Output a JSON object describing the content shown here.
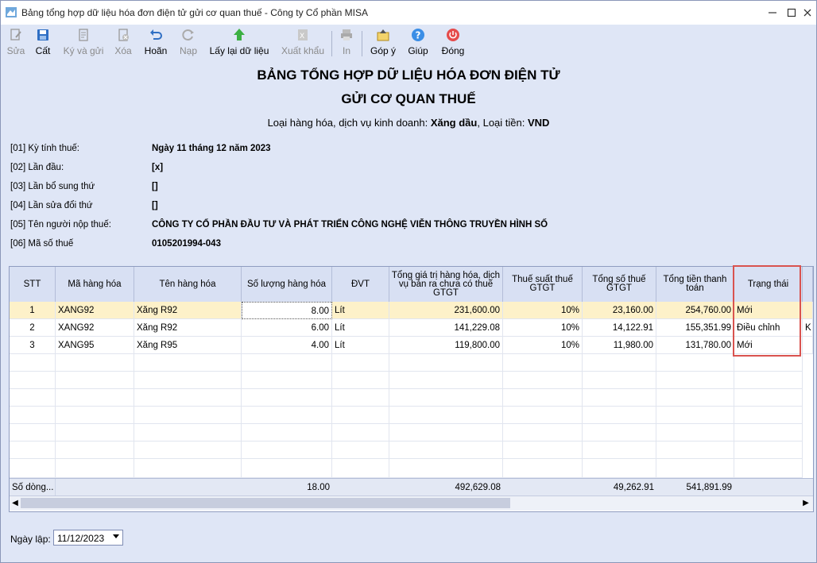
{
  "window": {
    "title": "Bảng tổng hợp dữ liệu hóa đơn điện tử gửi cơ quan thuế - Công ty Cổ phần MISA"
  },
  "toolbar": {
    "items": [
      {
        "label": "Sửa",
        "icon": "edit-icon",
        "disabled": true
      },
      {
        "label": "Cất",
        "icon": "save-icon",
        "disabled": false
      },
      {
        "label": "Ký và gửi",
        "icon": "sign-send-icon",
        "disabled": true
      },
      {
        "label": "Xóa",
        "icon": "delete-icon",
        "disabled": true
      },
      {
        "label": "Hoãn",
        "icon": "undo-icon",
        "disabled": false
      },
      {
        "label": "Nạp",
        "icon": "refresh-icon",
        "disabled": true
      },
      {
        "label": "Lấy lại dữ liệu",
        "icon": "reload-data-icon",
        "disabled": false
      },
      {
        "label": "Xuất khẩu",
        "icon": "export-icon",
        "disabled": true
      },
      {
        "label": "In",
        "icon": "print-icon",
        "disabled": true
      },
      {
        "label": "Góp ý",
        "icon": "feedback-icon",
        "disabled": false
      },
      {
        "label": "Giúp",
        "icon": "help-icon",
        "disabled": false
      },
      {
        "label": "Đóng",
        "icon": "close-power-icon",
        "disabled": false
      }
    ]
  },
  "report": {
    "title_line1": "BẢNG TỔNG HỢP DỮ LIỆU HÓA ĐƠN ĐIỆN TỬ",
    "title_line2": "GỬI CƠ QUAN THUẾ",
    "subtitle_prefix": "Loại hàng hóa, dịch vụ kinh doanh: ",
    "goods_type": "Xăng dầu",
    "subtitle_mid": ", Loại tiền: ",
    "currency": "VND"
  },
  "info": [
    {
      "label": "[01] Kỳ tính thuế:",
      "value": "Ngày 11 tháng 12 năm 2023"
    },
    {
      "label": "[02] Lần đầu:",
      "value": "[x]"
    },
    {
      "label": "[03] Lần bổ sung thứ",
      "value": "[]"
    },
    {
      "label": "[04] Lần sửa đổi thứ",
      "value": "[]"
    },
    {
      "label": "[05] Tên người nộp thuế:",
      "value": "CÔNG TY CỔ PHẦN ĐẦU TƯ VÀ PHÁT TRIỂN CÔNG NGHỆ VIỄN THÔNG TRUYỀN HÌNH SỐ"
    },
    {
      "label": "[06] Mã số thuế",
      "value": "0105201994-043"
    }
  ],
  "table": {
    "headers": [
      "STT",
      "Mã hàng hóa",
      "Tên hàng hóa",
      "Số lượng hàng hóa",
      "ĐVT",
      "Tổng giá trị hàng hóa, dịch vụ bán ra chưa có thuế GTGT",
      "Thuế suất thuế GTGT",
      "Tổng số thuế GTGT",
      "Tổng tiền thanh toán",
      "Trạng thái"
    ],
    "rows": [
      {
        "stt": "1",
        "code": "XANG92",
        "name": "Xăng R92",
        "qty": "8.00",
        "unit": "Lít",
        "value": "231,600.00",
        "rate": "10%",
        "tax": "23,160.00",
        "total": "254,760.00",
        "status": "Mới",
        "extra": ""
      },
      {
        "stt": "2",
        "code": "XANG92",
        "name": "Xăng R92",
        "qty": "6.00",
        "unit": "Lít",
        "value": "141,229.08",
        "rate": "10%",
        "tax": "14,122.91",
        "total": "155,351.99",
        "status": "Điều chỉnh",
        "extra": "K"
      },
      {
        "stt": "3",
        "code": "XANG95",
        "name": "Xăng R95",
        "qty": "4.00",
        "unit": "Lít",
        "value": "119,800.00",
        "rate": "10%",
        "tax": "11,980.00",
        "total": "131,780.00",
        "status": "Mới",
        "extra": ""
      }
    ],
    "footer": {
      "label": "Số dòng...",
      "qty": "18.00",
      "value": "492,629.08",
      "tax": "49,262.91",
      "total": "541,891.99"
    }
  },
  "date": {
    "label": "Ngày lập:",
    "value": "11/12/2023"
  },
  "colors": {
    "background": "#dfe6f6",
    "selected_row": "#fdf1c9",
    "highlight_border": "#d9534f",
    "header_bg": "#d8e0f3"
  }
}
